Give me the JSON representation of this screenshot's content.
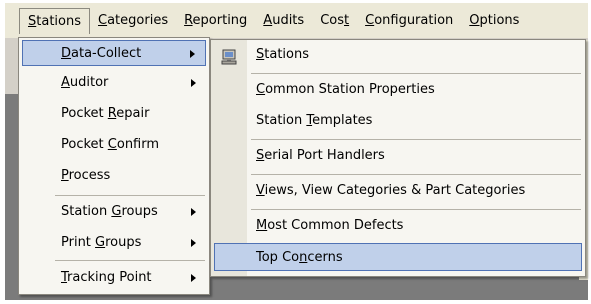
{
  "menubar": {
    "items": [
      {
        "label": "Stations",
        "accel": "S",
        "rest": "tations"
      },
      {
        "label": "Categories",
        "accel": "C",
        "rest": "ategories"
      },
      {
        "label": "Reporting",
        "accel": "R",
        "rest": "eporting"
      },
      {
        "label": "Audits",
        "accel": "A",
        "rest": "udits"
      },
      {
        "label": "Cost",
        "pre": "Cos",
        "accel": "t",
        "rest": ""
      },
      {
        "label": "Configuration",
        "accel": "C",
        "rest": "onfiguration"
      },
      {
        "label": "Options",
        "accel": "O",
        "rest": "ptions"
      }
    ]
  },
  "stations_menu": {
    "items": [
      {
        "accel": "D",
        "rest": "ata-Collect",
        "submenu": true,
        "highlighted": true
      },
      {
        "accel": "A",
        "rest": "uditor",
        "submenu": true
      },
      {
        "pre": "Pocket ",
        "accel": "R",
        "rest": "epair"
      },
      {
        "pre": "Pocket ",
        "accel": "C",
        "rest": "onfirm"
      },
      {
        "accel": "P",
        "rest": "rocess"
      },
      {
        "pre": "Station ",
        "accel": "G",
        "rest": "roups",
        "submenu": true
      },
      {
        "pre": "Print ",
        "accel": "G",
        "rest": "roups",
        "submenu": true
      },
      {
        "accel": "T",
        "rest": "racking Point",
        "submenu": true
      }
    ]
  },
  "data_collect_menu": {
    "items": [
      {
        "accel": "S",
        "rest": "tations",
        "icon": "station-icon"
      },
      {
        "accel": "C",
        "rest": "ommon Station Properties"
      },
      {
        "pre": "Station ",
        "accel": "T",
        "rest": "emplates"
      },
      {
        "accel": "S",
        "rest": "erial Port Handlers"
      },
      {
        "accel": "V",
        "rest": "iews, View Categories & Part Categories"
      },
      {
        "pre": "",
        "accel": "M",
        "rest": "ost Common Defects"
      },
      {
        "pre": "Top Co",
        "accel": "n",
        "rest": "cerns",
        "highlighted": true
      }
    ]
  }
}
